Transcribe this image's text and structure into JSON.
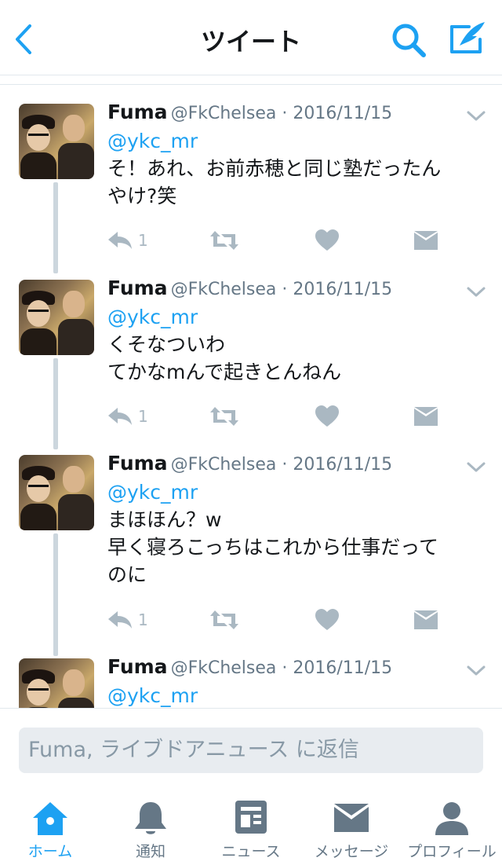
{
  "header": {
    "title": "ツイート"
  },
  "tweets": [
    {
      "name": "Fuma",
      "handle": "@FkChelsea · 2016/11/15",
      "mention": "@ykc_mr",
      "lines": [
        "そ！あれ、お前赤穂と同じ塾だったん",
        "やけ?笑",
        ""
      ],
      "reply_count": "1"
    },
    {
      "name": "Fuma",
      "handle": "@FkChelsea · 2016/11/15",
      "mention": "@ykc_mr",
      "lines": [
        "くそなついわ",
        "てかなmんで起きとんねん",
        ""
      ],
      "reply_count": "1"
    },
    {
      "name": "Fuma",
      "handle": "@FkChelsea · 2016/11/15",
      "mention": "@ykc_mr",
      "lines": [
        "まほほん？w",
        "早く寝ろこっちはこれから仕事だって",
        "のに"
      ],
      "reply_count": "1"
    },
    {
      "name": "Fuma",
      "handle": "@FkChelsea · 2016/11/15",
      "mention": "@ykc_mr",
      "lines": [
        "",
        "",
        ""
      ],
      "reply_count": ""
    }
  ],
  "reply": {
    "placeholder": "Fuma, ライブドアニュース に返信"
  },
  "tabbar": {
    "items": [
      {
        "label": "ホーム",
        "icon": "home-icon",
        "active": true
      },
      {
        "label": "通知",
        "icon": "bell-icon",
        "active": false
      },
      {
        "label": "ニュース",
        "icon": "news-icon",
        "active": false
      },
      {
        "label": "メッセージ",
        "icon": "envelope-icon",
        "active": false
      },
      {
        "label": "プロフィール",
        "icon": "person-icon",
        "active": false
      }
    ]
  },
  "colors": {
    "accent": "#1da1f2",
    "icon_gray": "#aab8c2",
    "text_secondary": "#657786",
    "thread_line": "#ccd6dd"
  }
}
